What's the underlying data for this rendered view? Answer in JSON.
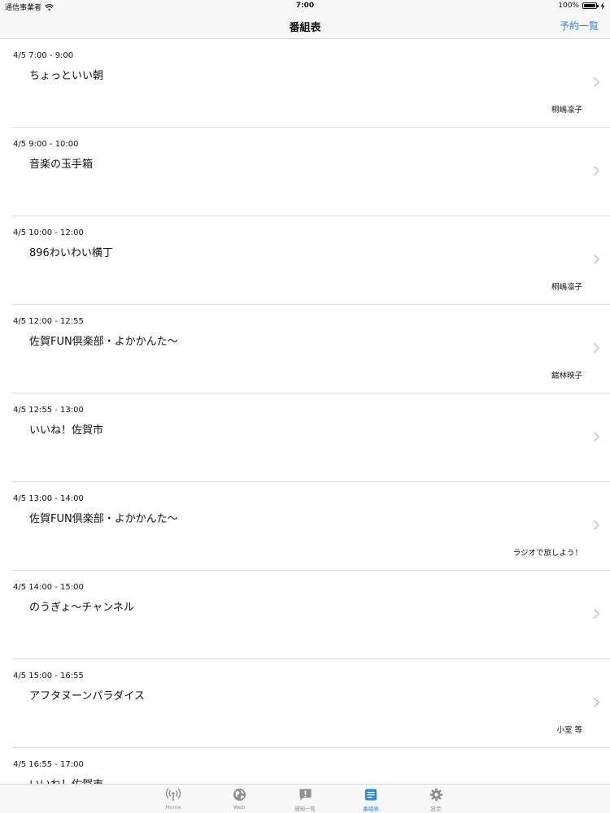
{
  "status_bar": {
    "carrier": "通信事業者",
    "time": "7:00",
    "battery": "100%",
    "battery_level": 1.0
  },
  "nav": {
    "title": "番組表",
    "action": "予約一覧"
  },
  "programs": [
    {
      "time": "4/5 7:00 - 9:00",
      "title": "ちょっといい朝",
      "host": "桐嶋凛子"
    },
    {
      "time": "4/5 9:00 - 10:00",
      "title": "音楽の玉手箱",
      "host": ""
    },
    {
      "time": "4/5 10:00 - 12:00",
      "title": "896わいわい横丁",
      "host": "桐嶋凛子"
    },
    {
      "time": "4/5 12:00 - 12:55",
      "title": "佐賀FUN倶楽部・よかかんた〜",
      "host": "舘林映子"
    },
    {
      "time": "4/5 12:55 - 13:00",
      "title": "いいね！佐賀市",
      "host": ""
    },
    {
      "time": "4/5 13:00 - 14:00",
      "title": "佐賀FUN倶楽部・よかかんた〜",
      "host": "ラジオで旅しよう！"
    },
    {
      "time": "4/5 14:00 - 15:00",
      "title": "のうぎょ〜チャンネル",
      "host": ""
    },
    {
      "time": "4/5 15:00 - 16:55",
      "title": "アフタヌーンパラダイス",
      "host": "小室 等"
    },
    {
      "time": "4/5 16:55 - 17:00",
      "title": "いいね！佐賀市",
      "host": ""
    }
  ],
  "tabs": [
    {
      "label": "Home",
      "icon": "radio-icon"
    },
    {
      "label": "Web",
      "icon": "globe-icon"
    },
    {
      "label": "通知一覧",
      "icon": "notice-icon"
    },
    {
      "label": "番組表",
      "icon": "schedule-icon"
    },
    {
      "label": "設定",
      "icon": "gear-icon"
    }
  ],
  "colors": {
    "accent": "#2f86e0",
    "inactive": "#8e8e93"
  }
}
